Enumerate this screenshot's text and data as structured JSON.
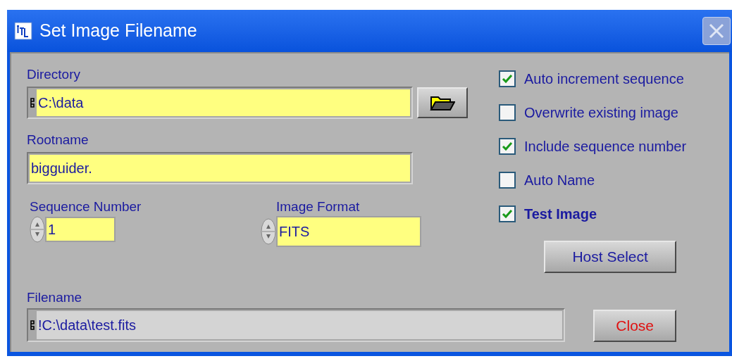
{
  "window": {
    "title": "Set Image Filename"
  },
  "directory": {
    "label": "Directory",
    "value": "C:\\data"
  },
  "rootname": {
    "label": "Rootname",
    "value": "bigguider."
  },
  "sequence_number": {
    "label": "Sequence Number",
    "value": "1"
  },
  "image_format": {
    "label": "Image Format",
    "value": "FITS"
  },
  "filename": {
    "label": "Filename",
    "value": "!C:\\data\\test.fits"
  },
  "options": [
    {
      "label": "Auto increment sequence",
      "checked": true,
      "bold": false
    },
    {
      "label": "Overwrite existing image",
      "checked": false,
      "bold": false
    },
    {
      "label": "Include sequence number",
      "checked": true,
      "bold": false
    },
    {
      "label": "Auto Name",
      "checked": false,
      "bold": false
    },
    {
      "label": "Test Image",
      "checked": true,
      "bold": true
    }
  ],
  "buttons": [
    {
      "label": "Host Select",
      "kind": "normal"
    },
    {
      "label": "Close",
      "kind": "danger"
    }
  ]
}
